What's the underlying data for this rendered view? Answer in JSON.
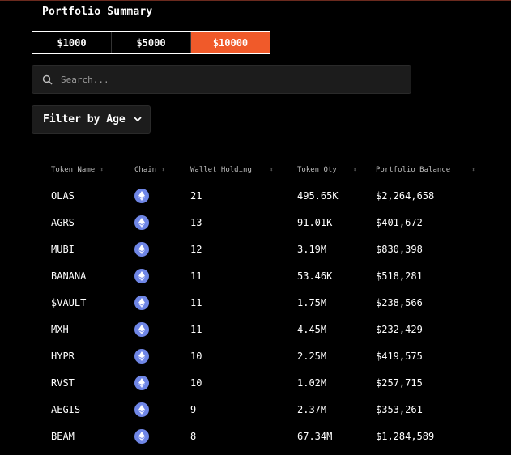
{
  "header": {
    "title": "Portfolio Summary"
  },
  "amount_tabs": [
    {
      "label": "$1000",
      "active": false
    },
    {
      "label": "$5000",
      "active": false
    },
    {
      "label": "$10000",
      "active": true
    }
  ],
  "search": {
    "placeholder": "Search..."
  },
  "filter": {
    "label": "Filter by Age"
  },
  "table": {
    "columns": [
      "Token Name",
      "Chain",
      "Wallet Holding",
      "Token Qty",
      "Portfolio Balance"
    ],
    "rows": [
      {
        "name": "OLAS",
        "chain": "ethereum-icon",
        "holding": "21",
        "qty": "495.65K",
        "balance": "$2,264,658"
      },
      {
        "name": "AGRS",
        "chain": "ethereum-icon",
        "holding": "13",
        "qty": "91.01K",
        "balance": "$401,672"
      },
      {
        "name": "MUBI",
        "chain": "ethereum-icon",
        "holding": "12",
        "qty": "3.19M",
        "balance": "$830,398"
      },
      {
        "name": "BANANA",
        "chain": "ethereum-icon",
        "holding": "11",
        "qty": "53.46K",
        "balance": "$518,281"
      },
      {
        "name": "$VAULT",
        "chain": "ethereum-icon",
        "holding": "11",
        "qty": "1.75M",
        "balance": "$238,566"
      },
      {
        "name": "MXH",
        "chain": "ethereum-icon",
        "holding": "11",
        "qty": "4.45M",
        "balance": "$232,429"
      },
      {
        "name": "HYPR",
        "chain": "ethereum-icon",
        "holding": "10",
        "qty": "2.25M",
        "balance": "$419,575"
      },
      {
        "name": "RVST",
        "chain": "ethereum-icon",
        "holding": "10",
        "qty": "1.02M",
        "balance": "$257,715"
      },
      {
        "name": "AEGIS",
        "chain": "ethereum-icon",
        "holding": "9",
        "qty": "2.37M",
        "balance": "$353,261"
      },
      {
        "name": "BEAM",
        "chain": "ethereum-icon",
        "holding": "8",
        "qty": "67.34M",
        "balance": "$1,284,589"
      }
    ]
  },
  "colors": {
    "accent": "#f05a2a",
    "eth": "#6f86e6",
    "panel": "#1c1c1c"
  }
}
